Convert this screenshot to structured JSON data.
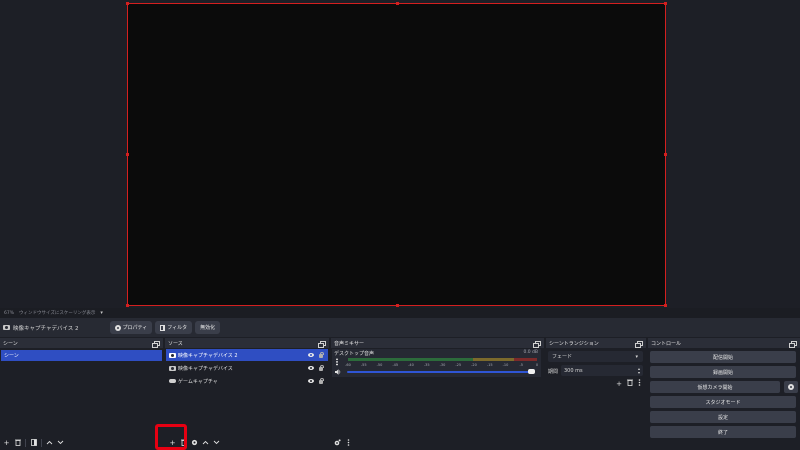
{
  "preview": {
    "zoom_label": "67%",
    "scale_mode_label": "ウィンドウサイズにスケーリング表示"
  },
  "source_toolbar": {
    "selected_source": "映像キャプチャデバイス 2",
    "properties_label": "プロパティ",
    "filters_label": "フィルタ",
    "deactivate_label": "無効化"
  },
  "scenes": {
    "title": "シーン",
    "items": [
      "シーン"
    ]
  },
  "sources": {
    "title": "ソース",
    "items": [
      {
        "name": "映像キャプチャデバイス 2",
        "icon": "camera-icon",
        "selected": true
      },
      {
        "name": "映像キャプチャデバイス",
        "icon": "camera-icon",
        "selected": false
      },
      {
        "name": "ゲームキャプチャ",
        "icon": "gamepad-icon",
        "selected": false
      }
    ]
  },
  "audio_mixer": {
    "title": "音声ミキサー",
    "channels": [
      {
        "name": "デスクトップ音声",
        "db": "0.0 dB",
        "volume": 1.0
      }
    ],
    "ticks": [
      "-60",
      "-55",
      "-50",
      "-45",
      "-40",
      "-35",
      "-30",
      "-25",
      "-20",
      "-15",
      "-10",
      "-5",
      "0"
    ]
  },
  "transitions": {
    "title": "シーントランジション",
    "selected": "フェード",
    "duration_label": "期間",
    "duration_value": "300 ms"
  },
  "controls": {
    "title": "コントロール",
    "buttons": [
      "配信開始",
      "録画開始",
      "仮想カメラ開始",
      "スタジオモード",
      "設定",
      "終了"
    ]
  },
  "colors": {
    "accent": "#2f4ec2",
    "highlight": "#e60012",
    "selection_border": "#d41f1f"
  }
}
